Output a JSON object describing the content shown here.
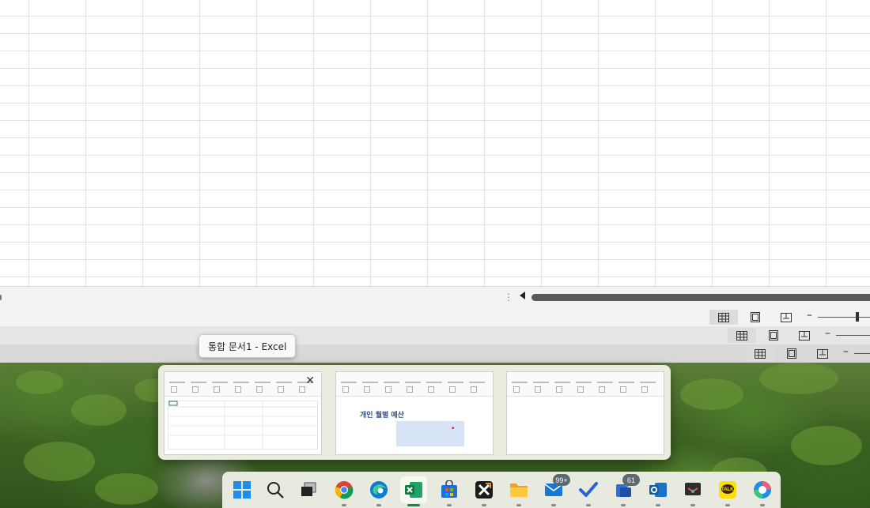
{
  "tooltip": {
    "text": "통합 문서1 - Excel"
  },
  "thumbnails": [
    {
      "id": "blank-workbook"
    },
    {
      "id": "budget-workbook",
      "title": "개인 월별 예산"
    },
    {
      "id": "third-workbook"
    }
  ],
  "taskbar": {
    "items": [
      {
        "name": "start",
        "icon": "windows-start-icon"
      },
      {
        "name": "search",
        "icon": "search-icon"
      },
      {
        "name": "task-view",
        "icon": "task-view-icon"
      },
      {
        "name": "chrome",
        "icon": "chrome-icon"
      },
      {
        "name": "edge",
        "icon": "edge-icon"
      },
      {
        "name": "excel",
        "icon": "excel-icon",
        "active": true
      },
      {
        "name": "store",
        "icon": "microsoft-store-icon"
      },
      {
        "name": "app-x",
        "icon": "x-app-icon"
      },
      {
        "name": "file-explorer",
        "icon": "folder-icon"
      },
      {
        "name": "mail",
        "icon": "mail-icon",
        "badge": "99+"
      },
      {
        "name": "todo",
        "icon": "checkmark-icon"
      },
      {
        "name": "teams",
        "icon": "teams-icon",
        "badge": "61"
      },
      {
        "name": "outlook",
        "icon": "outlook-icon"
      },
      {
        "name": "snipping",
        "icon": "snipping-tool-icon"
      },
      {
        "name": "kakaotalk",
        "icon": "kakaotalk-icon",
        "label": "TALK"
      },
      {
        "name": "copilot",
        "icon": "copilot-icon"
      }
    ]
  },
  "colors": {
    "excel_green": "#1f7244",
    "taskbar_bg": "#e8eadf",
    "badge_bg": "#5a6a6e"
  }
}
